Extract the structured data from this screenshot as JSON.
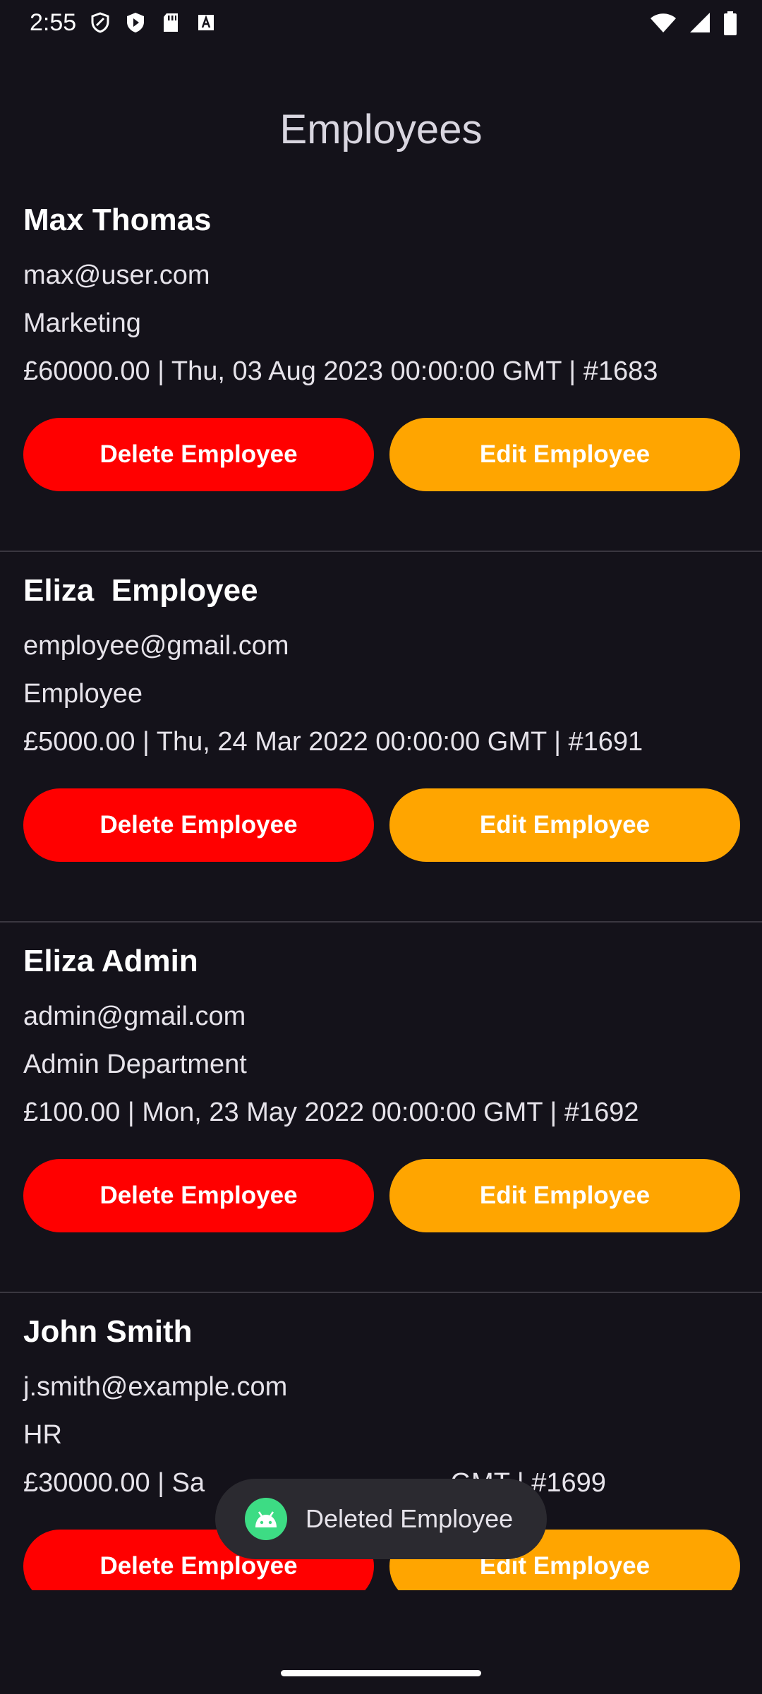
{
  "status_bar": {
    "time": "2:55",
    "left_icons": [
      "shield-icon",
      "play-protect-icon",
      "sd-card-icon",
      "keyboard-a-icon"
    ],
    "right_icons": [
      "wifi-icon",
      "signal-icon",
      "battery-icon"
    ]
  },
  "header": {
    "title": "Employees"
  },
  "employees": [
    {
      "name": "Max Thomas",
      "email": "max@user.com",
      "department": "Marketing",
      "meta": "£60000.00 | Thu, 03 Aug 2023 00:00:00 GMT | #1683",
      "delete_label": "Delete Employee",
      "edit_label": "Edit Employee"
    },
    {
      "name": "Eliza  Employee",
      "email": "employee@gmail.com",
      "department": "Employee",
      "meta": "£5000.00 | Thu, 24 Mar 2022 00:00:00 GMT | #1691",
      "delete_label": "Delete Employee",
      "edit_label": "Edit Employee"
    },
    {
      "name": "Eliza Admin",
      "email": "admin@gmail.com",
      "department": "Admin Department",
      "meta": "£100.00 | Mon, 23 May 2022 00:00:00 GMT | #1692",
      "delete_label": "Delete Employee",
      "edit_label": "Edit Employee"
    },
    {
      "name": "John Smith",
      "email": "j.smith@example.com",
      "department": "HR",
      "meta": "£30000.00 | Sa                                 GMT | #1699",
      "delete_label": "Delete Employee",
      "edit_label": "Edit Employee"
    }
  ],
  "toast": {
    "text": "Deleted Employee",
    "icon": "android-icon"
  },
  "colors": {
    "background": "#14121a",
    "delete_button": "#ff0000",
    "edit_button": "#ffa500",
    "toast_background": "#2b2a30",
    "android_green": "#3ddc84"
  }
}
